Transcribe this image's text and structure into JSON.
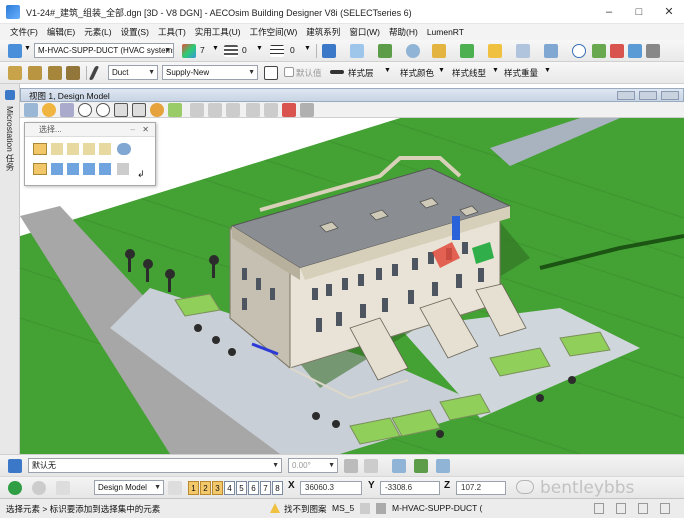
{
  "window": {
    "title": "V1-24#_建筑_组装_全部.dgn [3D - V8 DGN] - AECOsim Building Designer V8i (SELECTseries 6)",
    "minimize": "–",
    "maximize": "□",
    "close": "✕"
  },
  "menu": [
    "文件(F)",
    "编辑(E)",
    "元素(L)",
    "设置(S)",
    "工具(T)",
    "实用工具(U)",
    "工作空间(W)",
    "建筑系列",
    "窗口(W)",
    "帮助(H)",
    "LumenRT"
  ],
  "toolbar1": {
    "system_combo": "M-HVAC-SUPP-DUCT (HVAC systems",
    "color_value": "7",
    "weight_value": "0",
    "style_value": "0"
  },
  "toolbar2": {
    "type_combo": "Duct",
    "family_combo": "Supply-New",
    "checkbox_label": "默认值",
    "style_layer": "样式层",
    "style_color": "样式颜色",
    "style_linetype": "样式线型",
    "style_weight": "样式重量"
  },
  "left_strip": {
    "label": "Microstation 任务"
  },
  "view": {
    "title": "视图 1, Design Model"
  },
  "palette": {
    "title": "选择..."
  },
  "bottom1": {
    "level_combo": "默认无",
    "angle_value": "0.00°"
  },
  "bottom2": {
    "model_combo": "Design Model",
    "view_numbers": [
      "1",
      "2",
      "3",
      "4",
      "5",
      "6",
      "7",
      "8"
    ],
    "active_views": [
      "1",
      "2",
      "3"
    ],
    "x_label": "X",
    "x_value": "36060.3",
    "y_label": "Y",
    "y_value": "-3308.6",
    "z_label": "Z",
    "z_value": "107.2",
    "watermark": "bentleybbs"
  },
  "status": {
    "message": "选择元素 > 标识要添加到选择集中的元素",
    "warning": "找不到图案",
    "snap": "MS_5",
    "active_level": "M-HVAC-SUPP-DUCT ("
  },
  "colors": {
    "accent_blue": "#2d7bd6",
    "lawn_green": "#3f9a2e",
    "roof_grey": "#8a8e93"
  }
}
